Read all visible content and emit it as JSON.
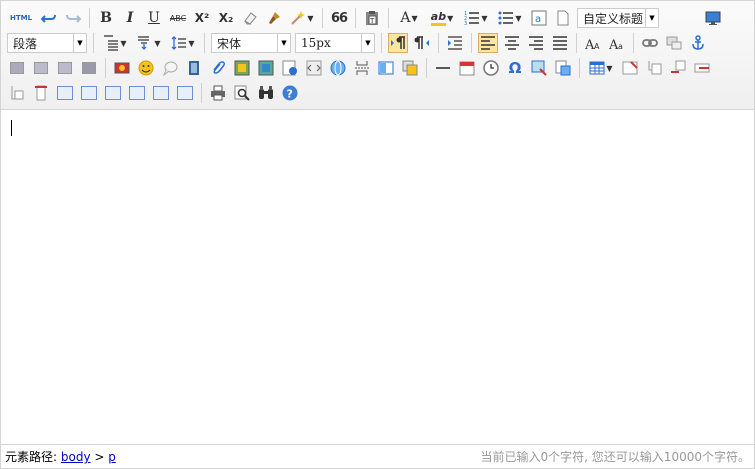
{
  "toolbar": {
    "row1": {
      "html_label": "HTML",
      "bold": "B",
      "italic": "I",
      "underline": "U",
      "strike": "ABC",
      "superscript": "X²",
      "subscript": "X₂",
      "blockquote": "66",
      "font_color": "A",
      "highlight": "ab",
      "custom_title_select": "自定义标题"
    },
    "row2": {
      "paragraph_select": "段落",
      "font_family_select": "宋体",
      "font_size_select": "15px"
    },
    "row3": {
      "omega": "Ω"
    }
  },
  "statusbar": {
    "path_label": "元素路径:",
    "path_body": "body",
    "path_sep": ">",
    "path_p": "p",
    "counter_text": "当前已输入0个字符, 您还可以输入10000个字符。"
  },
  "colors": {
    "active_bg": "#ffe69f",
    "link": "#0000cc",
    "blue_icon": "#3b7fd4"
  },
  "icons": {
    "undo": "undo-icon",
    "redo": "redo-icon",
    "eraser": "eraser-icon",
    "format_brush": "format-brush-icon",
    "magic": "magic-wand-icon",
    "paste": "paste-plain-icon",
    "help": "help-icon",
    "print": "print-icon",
    "preview": "preview-icon",
    "search": "search-replace-icon"
  }
}
